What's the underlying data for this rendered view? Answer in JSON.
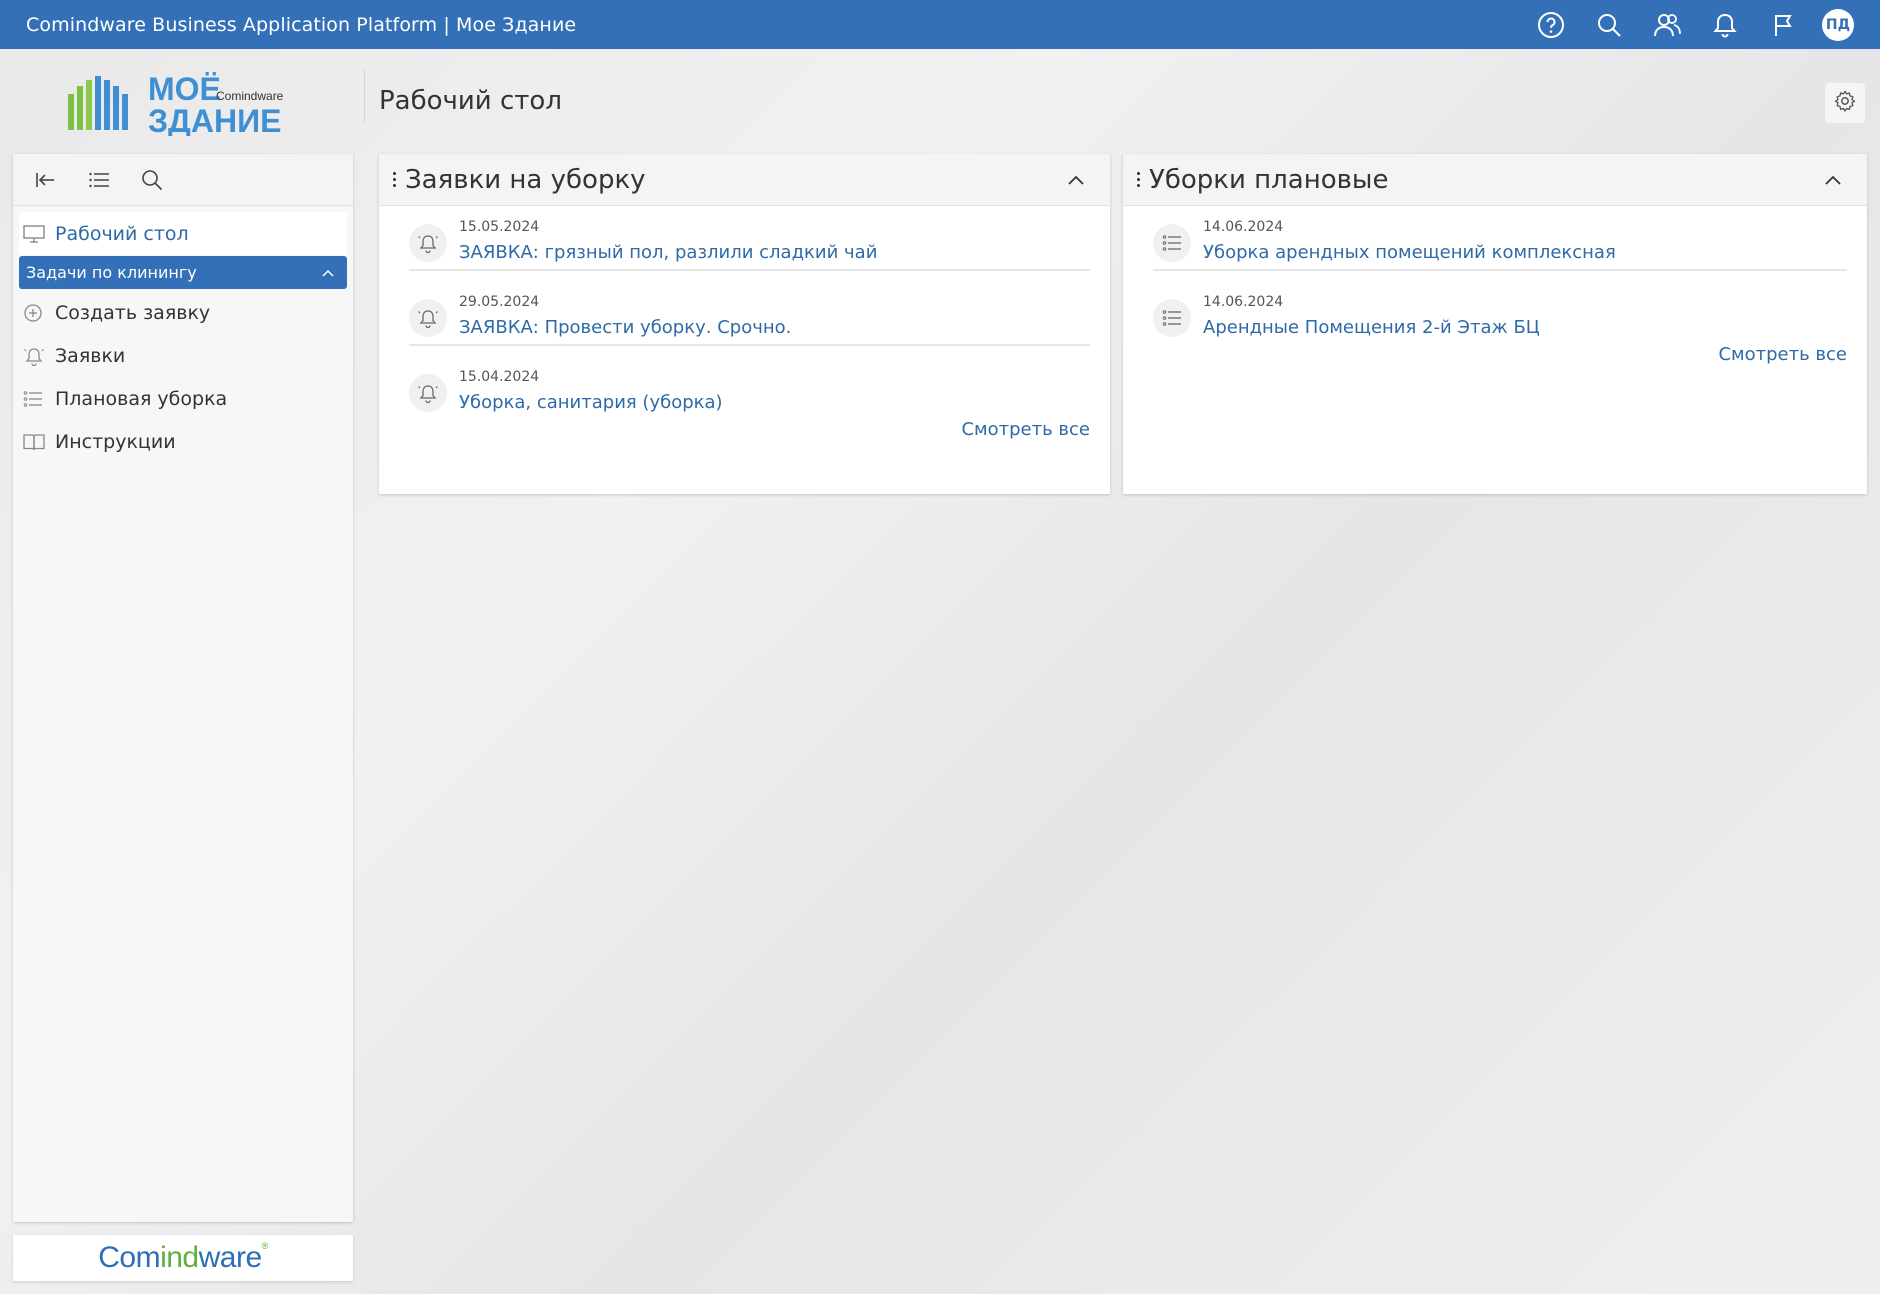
{
  "topbar": {
    "title": "Comindware Business Application Platform  |  Мое Здание",
    "avatar": "ПД",
    "icons": [
      "help-icon",
      "search-icon",
      "users-icon",
      "bell-icon",
      "flag-icon"
    ]
  },
  "logo": {
    "line1": "МОЁ",
    "line2": "ЗДАНИЕ",
    "brand_small": "Comindware"
  },
  "page": {
    "title": "Рабочий стол"
  },
  "sidebar": {
    "desktop_label": "Рабочий стол",
    "group_label": "Задачи по клинингу",
    "items": [
      {
        "label": "Создать заявку",
        "icon": "plus-circle-icon"
      },
      {
        "label": "Заявки",
        "icon": "bell-icon"
      },
      {
        "label": "Плановая уборка",
        "icon": "list-icon"
      },
      {
        "label": "Инструкции",
        "icon": "book-icon"
      }
    ],
    "footer_brand_a": "Com",
    "footer_brand_b": "ind",
    "footer_brand_c": "ware"
  },
  "cards": [
    {
      "title": "Заявки на уборку",
      "see_all": "Смотреть все",
      "records": [
        {
          "date": "15.05.2024",
          "title": "ЗАЯВКА: грязный пол, разлили сладкий чай"
        },
        {
          "date": "29.05.2024",
          "title": "ЗАЯВКА: Провести уборку. Срочно."
        },
        {
          "date": "15.04.2024",
          "title": "Уборка, санитария (уборка)"
        }
      ]
    },
    {
      "title": "Уборки плановые",
      "see_all": "Смотреть все",
      "records": [
        {
          "date": "14.06.2024",
          "title": "Уборка арендных помещений комплексная"
        },
        {
          "date": "14.06.2024",
          "title": "Арендные Помещения 2-й Этаж БЦ"
        }
      ]
    }
  ],
  "colors": {
    "primary": "#3470b7",
    "link": "#2f6aa8",
    "brand_green": "#5fae3e"
  }
}
